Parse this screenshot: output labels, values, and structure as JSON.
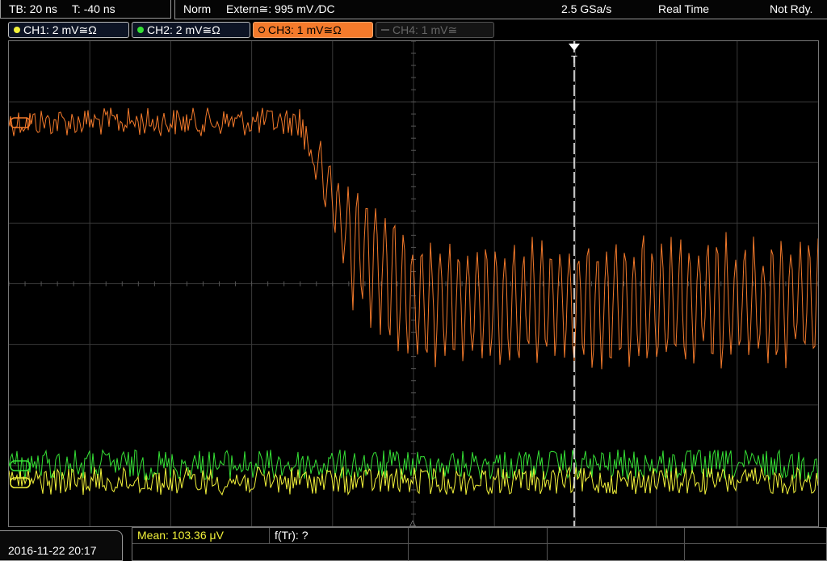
{
  "status": {
    "timebase": "TB: 20 ns",
    "trigger_time": "T: -40 ns",
    "trigger_mode": "Norm",
    "trigger_source": "Extern≅: 995 mV ∕DC",
    "sample_rate": "2.5 GSa/s",
    "acq_mode": "Real Time",
    "state": "Not Rdy."
  },
  "channels": [
    {
      "label": "CH1: 2 mV≅Ω",
      "color": "#f2f23a",
      "active": true
    },
    {
      "label": "CH2: 2 mV≅Ω",
      "color": "#35e035",
      "active": true
    },
    {
      "label": "CH3: 1 mV≅Ω",
      "color": "#f47a2b",
      "active": true,
      "selected": true
    },
    {
      "label": "CH4: 1 mV≅",
      "color": "#555555",
      "active": false
    }
  ],
  "colors": {
    "ch1": "#f2f23a",
    "ch2": "#35e035",
    "ch3": "#f47a2b",
    "grid": "#3a3a3a",
    "trigger_marker": "#ffffff"
  },
  "markers": {
    "trigger_marker_label": "T",
    "ground_marker_label": "△"
  },
  "measurements": {
    "mean": "Mean: 103.36 μV",
    "rise_freq": "f(Tr): ?"
  },
  "datetime": "2016-11-22 20:17",
  "icons": [
    "channel-dot-icon",
    "trigger-position-icon",
    "ground-reference-icon"
  ]
}
